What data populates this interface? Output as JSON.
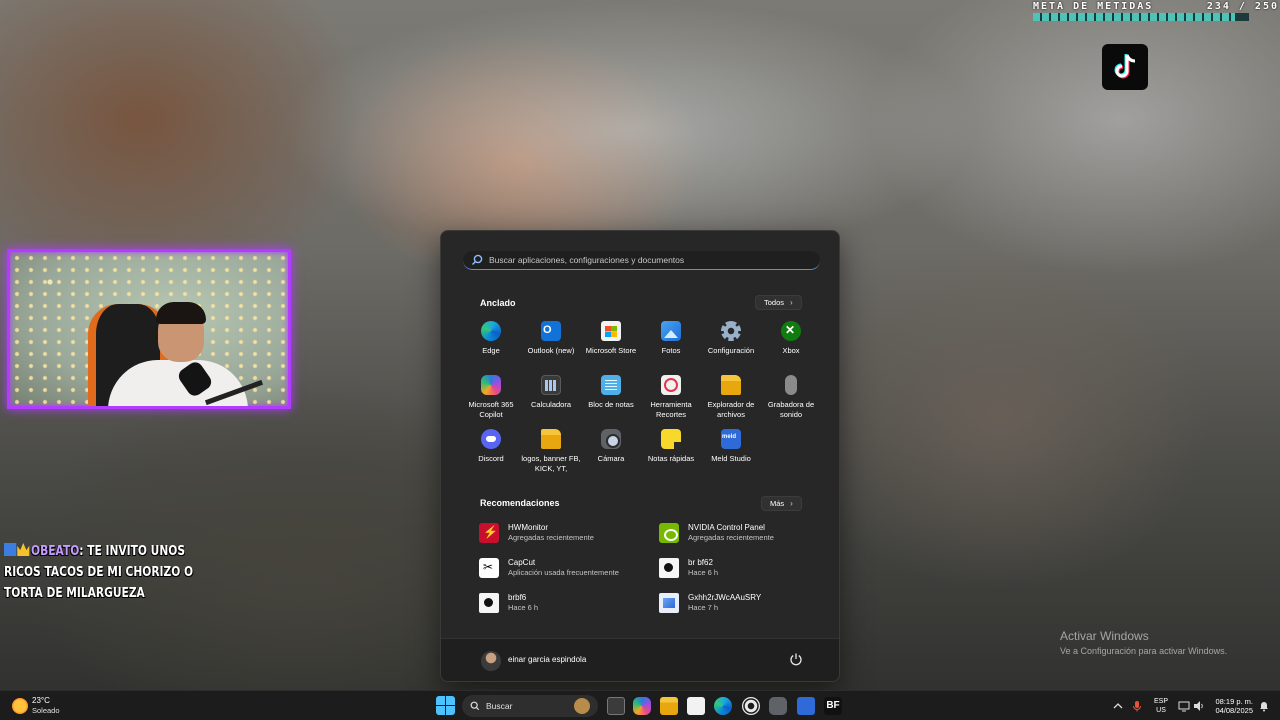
{
  "overlay": {
    "goal_label": "META DE METIDAS",
    "goal_count": "234 / 250",
    "goal_progress": 0.936
  },
  "chat": {
    "user": "OBEATO",
    "message": ": TE INVITO UNOS RICOS TACOS DE MI CHORIZO O TORTA DE MILARGUEZA"
  },
  "activation": {
    "title": "Activar Windows",
    "subtitle": "Ve a Configuración para activar Windows."
  },
  "start_menu": {
    "search_placeholder": "Buscar aplicaciones, configuraciones y documentos",
    "pinned_title": "Anclado",
    "pinned_button": "Todos",
    "pinned": [
      {
        "label": "Edge",
        "icon": "edge-icon"
      },
      {
        "label": "Outlook (new)",
        "icon": "outlook-icon"
      },
      {
        "label": "Microsoft Store",
        "icon": "store-icon"
      },
      {
        "label": "Fotos",
        "icon": "photos-icon"
      },
      {
        "label": "Configuración",
        "icon": "settings-icon"
      },
      {
        "label": "Xbox",
        "icon": "xbox-icon"
      },
      {
        "label": "Microsoft 365 Copilot",
        "icon": "m365-copilot-icon"
      },
      {
        "label": "Calculadora",
        "icon": "calculator-icon"
      },
      {
        "label": "Bloc de notas",
        "icon": "notepad-icon"
      },
      {
        "label": "Herramienta Recortes",
        "icon": "snipping-tool-icon"
      },
      {
        "label": "Explorador de archivos",
        "icon": "file-explorer-icon"
      },
      {
        "label": "Grabadora de sonido",
        "icon": "sound-recorder-icon"
      },
      {
        "label": "Discord",
        "icon": "discord-icon"
      },
      {
        "label": "logos, banner FB, KICK, YT,",
        "icon": "folder-icon"
      },
      {
        "label": "Cámara",
        "icon": "camera-icon"
      },
      {
        "label": "Notas rápidas",
        "icon": "sticky-notes-icon"
      },
      {
        "label": "Meld Studio",
        "icon": "meld-icon"
      }
    ],
    "recommended_title": "Recomendaciones",
    "recommended_button": "Más",
    "recommended": [
      {
        "title": "HWMonitor",
        "sub": "Agregadas recientemente",
        "icon": "hwmonitor-icon"
      },
      {
        "title": "NVIDIA Control Panel",
        "sub": "Agregadas recientemente",
        "icon": "nvidia-icon"
      },
      {
        "title": "CapCut",
        "sub": "Aplicación usada frecuentemente",
        "icon": "capcut-icon"
      },
      {
        "title": "br bf62",
        "sub": "Hace 6 h",
        "icon": "file-icon"
      },
      {
        "title": "brbf6",
        "sub": "Hace 6 h",
        "icon": "file-icon"
      },
      {
        "title": "Gxhh2rJWcAAuSRY",
        "sub": "Hace 7 h",
        "icon": "image-file-icon"
      }
    ],
    "user_name": "einar garcia espindola"
  },
  "taskbar": {
    "weather_temp": "23°C",
    "weather_desc": "Soleado",
    "search_label": "Buscar",
    "lang_top": "ESP",
    "lang_bottom": "US",
    "time": "08:19 p. m.",
    "date": "04/08/2025",
    "app_icons": [
      "task-view-icon",
      "copilot-icon",
      "file-explorer-icon",
      "store-icon",
      "edge-icon",
      "obs-icon",
      "camera-icon",
      "meld-icon",
      "bf-icon"
    ]
  },
  "colors": {
    "accent": "#4cc2ff",
    "webcam_border": "#b13cff",
    "goal_fill": "#4ec3b8",
    "start_bg": "#272727"
  }
}
